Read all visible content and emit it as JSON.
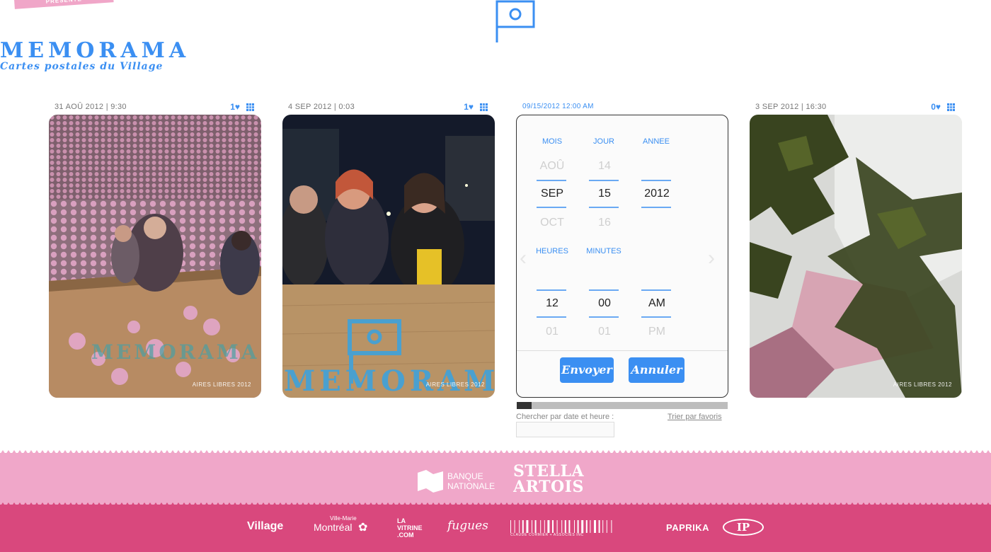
{
  "ribbon": {
    "text": "PRÉSENTÉ"
  },
  "logo": {
    "title": "MEMORAMA",
    "subtitle": "Cartes postales du Village"
  },
  "cards": [
    {
      "date": "31 AOÛ 2012 | 9:30",
      "likes": "1♥",
      "caption": "AIRES LIBRES 2012"
    },
    {
      "date": "4 SEP 2012 | 0:03",
      "likes": "1♥",
      "caption": "AIRES LIBRES 2012"
    },
    {
      "date": "3 SEP 2012 | 16:30",
      "likes": "0♥",
      "caption": "AIRES LIBRES 2012"
    }
  ],
  "picker": {
    "header": "09/15/2012 12:00 AM",
    "labels": {
      "month": "MOIS",
      "day": "JOUR",
      "year": "ANNEE",
      "hours": "HEURES",
      "minutes": "MINUTES"
    },
    "month": {
      "prev": "AOÛ",
      "current": "SEP",
      "next": "OCT"
    },
    "day": {
      "prev": "14",
      "current": "15",
      "next": "16"
    },
    "year": {
      "prev": "",
      "current": "2012",
      "next": ""
    },
    "hour": {
      "prev": "",
      "current": "12",
      "next": "01"
    },
    "minute": {
      "prev": "",
      "current": "00",
      "next": "01"
    },
    "ampm": {
      "prev": "",
      "current": "AM",
      "next": "PM"
    },
    "send_label": "Envoyer",
    "cancel_label": "Annuler"
  },
  "progress": {
    "fraction": 0.07
  },
  "search": {
    "label": "Chercher par date et heure :",
    "value": "",
    "sort_label": "Trier par favoris"
  },
  "sponsors": {
    "bank_line1": "BANQUE",
    "bank_line2": "NATIONALE",
    "stella_line1": "STELLA",
    "stella_line2": "ARTOIS",
    "partners": [
      "Village",
      "Ville-Marie",
      "Montréal",
      "LA VITRINE .COM",
      "fugues",
      "CLAUDE CORMIER + ASSOCIÉS INC",
      "PAPRIKA",
      "IP"
    ]
  },
  "colors": {
    "accent": "#3b8ff2",
    "pink_band": "#f0a7c9",
    "dark_band": "#d9487d"
  }
}
